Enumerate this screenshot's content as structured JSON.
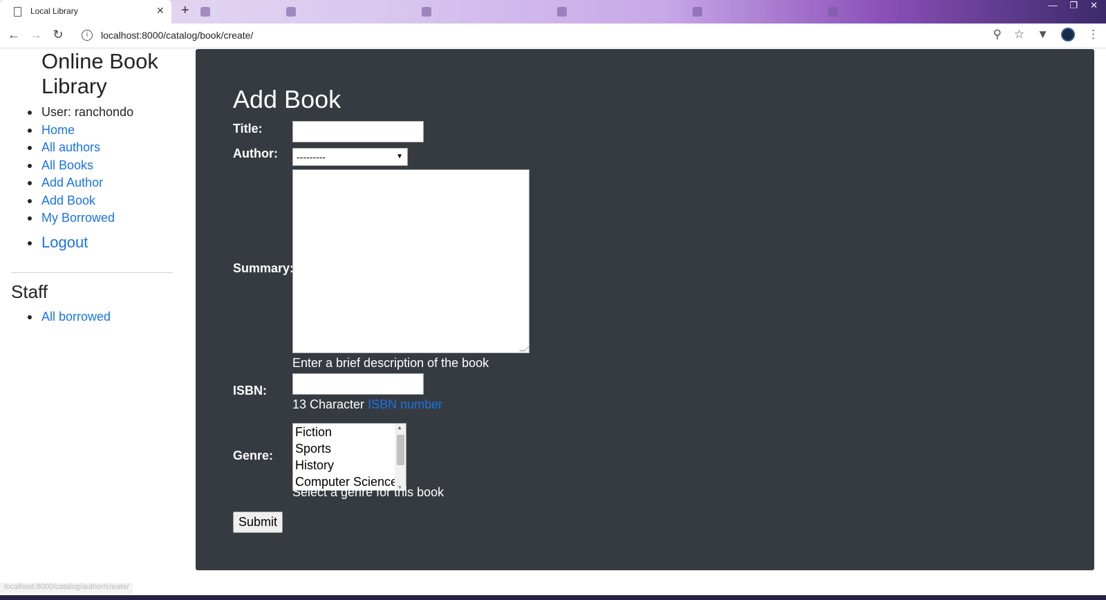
{
  "browser": {
    "active_tab_title": "Local Library",
    "close_glyph": "✕",
    "new_tab_glyph": "+",
    "url": "localhost:8000/catalog/book/create/",
    "status_url": "localhost:8000/catalog/author/create/"
  },
  "sidebar": {
    "site_title": "Online Book Library",
    "nav": [
      {
        "label": "User: ranchondo",
        "link": false
      },
      {
        "label": "Home",
        "link": true
      },
      {
        "label": "All authors",
        "link": true
      },
      {
        "label": "All Books",
        "link": true
      },
      {
        "label": "Add Author",
        "link": true
      },
      {
        "label": "Add Book",
        "link": true
      },
      {
        "label": "My Borrowed",
        "link": true
      },
      {
        "label": "Logout",
        "link": true
      }
    ],
    "staff_title": "Staff",
    "staff_nav": [
      {
        "label": "All borrowed",
        "link": true
      }
    ]
  },
  "form": {
    "heading": "Add Book",
    "title_label": "Title:",
    "title_value": "",
    "author_label": "Author:",
    "author_selected": "---------",
    "summary_label": "Summary:",
    "summary_value": "",
    "summary_help": "Enter a brief description of the book",
    "isbn_label": "ISBN:",
    "isbn_value": "",
    "isbn_help_prefix": "13 Character ",
    "isbn_help_link": "ISBN number",
    "genre_label": "Genre:",
    "genre_options": [
      "Fiction",
      "Sports",
      "History",
      "Computer Science"
    ],
    "genre_help": "Select a genre for this book",
    "submit_label": "Submit"
  },
  "colors": {
    "content_bg": "#363b41",
    "link": "#1a73e8"
  }
}
